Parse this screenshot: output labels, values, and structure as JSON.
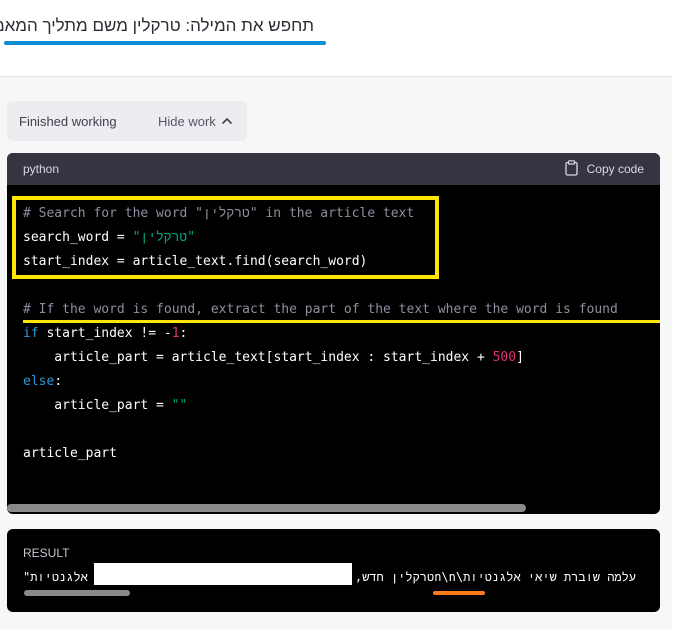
{
  "user_message": "תחפש את המילה: טרקלין  משם מתליך המאמר",
  "work_toggle": {
    "status_label": "Finished working",
    "hide_label": "Hide work",
    "chevron_icon": "chevron-up-icon"
  },
  "code_block": {
    "language": "python",
    "copy_label": "Copy code",
    "copy_icon": "clipboard-icon",
    "lines": {
      "l1": "# Search for the word \"טרקלין\" in the article text",
      "l2_var": "search_word",
      "l2_op": " = ",
      "l2_str": "\"טרקלין\"",
      "l3": "start_index = article_text.find(search_word)",
      "l5": "# If the word is found, extract the part of the text where the word is found",
      "l6_kw": "if",
      "l6_a": " start_index != -",
      "l6_num": "1",
      "l6_b": ":",
      "l7_a": "    article_part = article_text[start_index : start_index + ",
      "l7_num": "500",
      "l7_b": "]",
      "l8_kw": "else",
      "l8_b": ":",
      "l9_a": "    article_part = ",
      "l9_str": "\"\"",
      "l11": "article_part"
    }
  },
  "result": {
    "label": "RESULT",
    "text_rtl": "עלמה שוברת שיאי אלגנטיות\\n\\nטרקלין חדש, ב",
    "text_start": "\"אי אלגנטיות"
  },
  "colors": {
    "highlight_box": "#ffe600",
    "highlight_orange": "#ff7a1a",
    "highlight_blue": "#0a8fd6"
  }
}
